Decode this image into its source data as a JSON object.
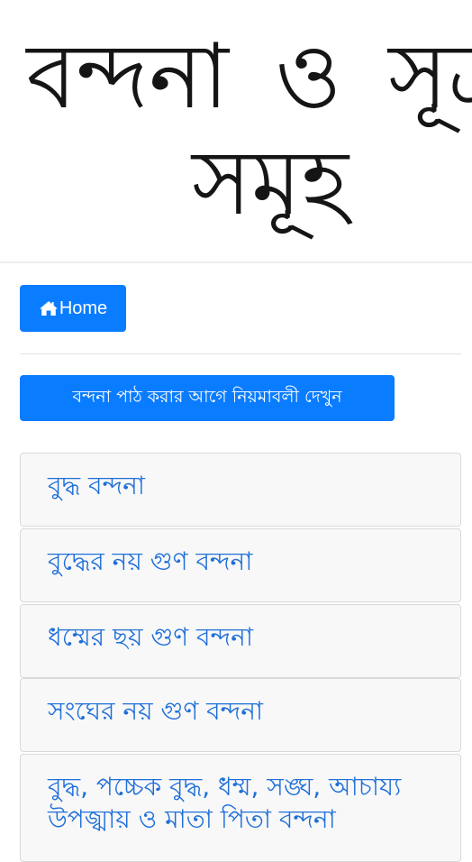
{
  "header": {
    "title": "বন্দনা ও সূত্র সমূহ"
  },
  "nav": {
    "home_label": "Home",
    "home_icon": "home-icon"
  },
  "rules_button": {
    "label": "বন্দনা পাঠ করার আগে নিয়মাবলী দেখুন"
  },
  "list": {
    "items": [
      {
        "label": "বুদ্ধ বন্দনা"
      },
      {
        "label": "বুদ্ধের নয় গুণ বন্দনা"
      },
      {
        "label": "ধম্মের ছয় গুণ বন্দনা"
      },
      {
        "label": "সংঘের নয় গুণ বন্দনা"
      },
      {
        "label": "বুদ্ধ, পচ্চেক বুদ্ধ, ধম্ম, সঙ্ঘ, আচায্য উপজ্ঝায় ও মাতা পিতা বন্দনা"
      }
    ]
  },
  "colors": {
    "primary_button": "#0a7cff",
    "link_text": "#1e6fd9",
    "list_background": "#f8f8f8"
  }
}
